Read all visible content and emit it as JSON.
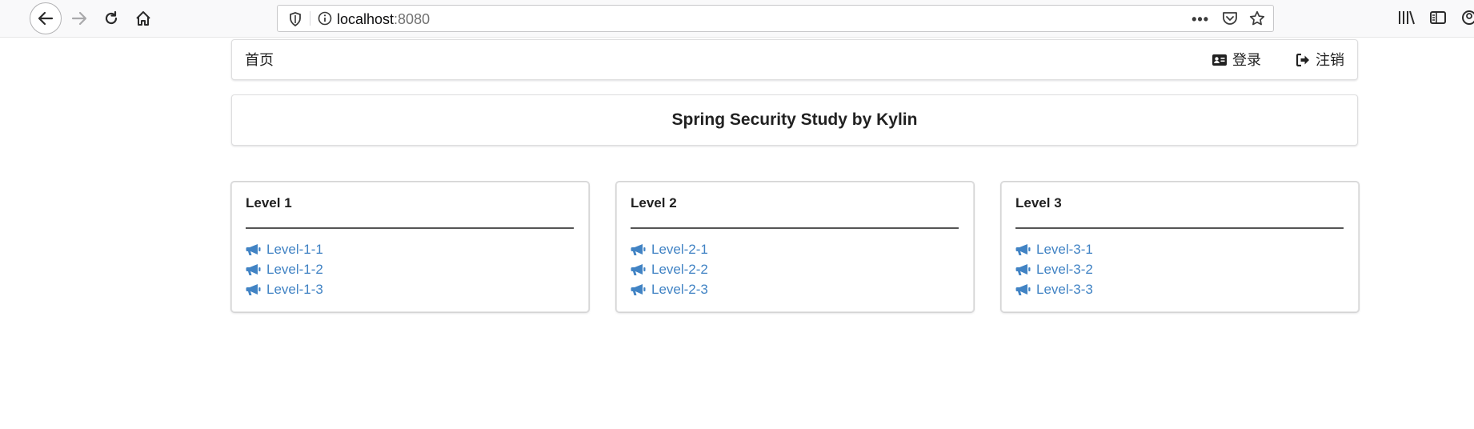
{
  "browser": {
    "url_host": "localhost",
    "url_port": ":8080",
    "icons": [
      "back-icon",
      "forward-icon",
      "reload-icon",
      "home-icon",
      "shield-icon",
      "info-icon",
      "more-icon",
      "pocket-icon",
      "star-icon",
      "library-icon",
      "sidebar-icon",
      "account-icon"
    ]
  },
  "menu": {
    "home_label": "首页",
    "login_label": "登录",
    "logout_label": "注销"
  },
  "header": {
    "title": "Spring Security Study by Kylin"
  },
  "cards": [
    {
      "title": "Level 1",
      "links": [
        "Level-1-1",
        "Level-1-2",
        "Level-1-3"
      ]
    },
    {
      "title": "Level 2",
      "links": [
        "Level-2-1",
        "Level-2-2",
        "Level-2-3"
      ]
    },
    {
      "title": "Level 3",
      "links": [
        "Level-3-1",
        "Level-3-2",
        "Level-3-3"
      ]
    }
  ],
  "colors": {
    "link": "#4183c4",
    "text": "#212121",
    "border": "#d4d4d5"
  }
}
